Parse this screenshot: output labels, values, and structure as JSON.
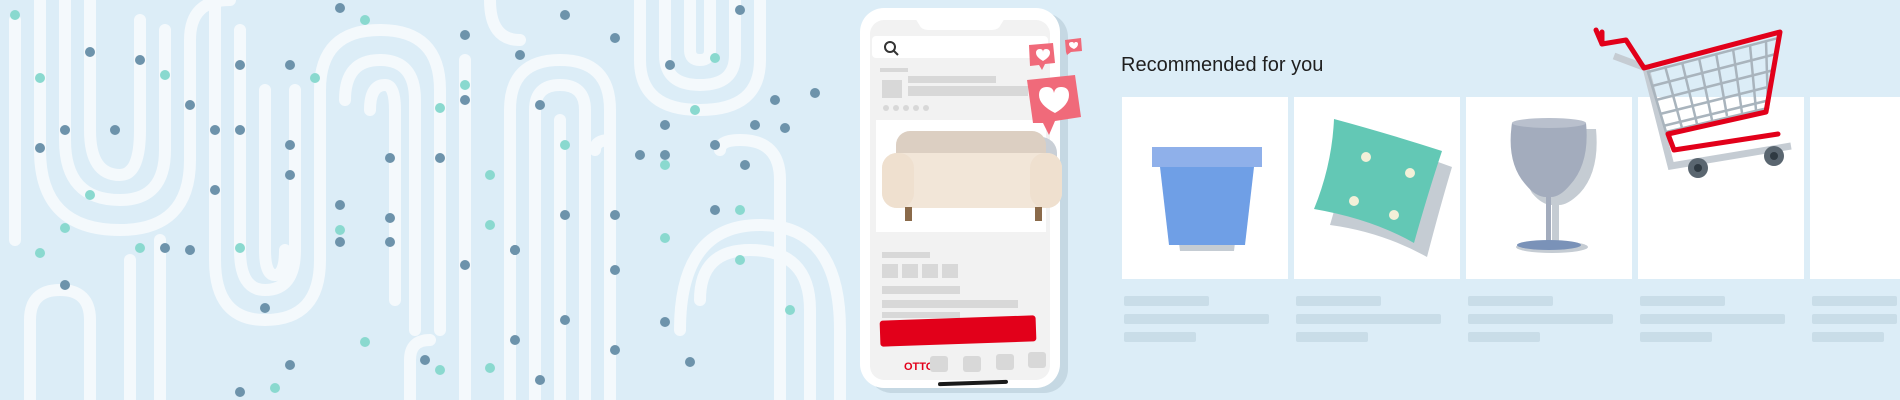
{
  "section": {
    "title": "Recommended for you"
  },
  "phone": {
    "brand_logo": "OTTO",
    "rating_stars": 5,
    "nav_icon_count": 4,
    "notification_badges": 3
  },
  "products": [
    {
      "name": "plant-pot-icon"
    },
    {
      "name": "cushion-icon"
    },
    {
      "name": "wine-glass-icon"
    },
    {
      "name": "empty-product"
    },
    {
      "name": "empty-product"
    }
  ],
  "colors": {
    "background": "#dcedf7",
    "accent_red": "#e2001a",
    "dot_blue": "#6d93ab",
    "dot_teal": "#8ad9cf",
    "card": "#ffffff",
    "skeleton": "#c9dde8"
  },
  "icons": [
    "search-icon",
    "heart-icon",
    "sofa-icon",
    "shopping-cart-icon",
    "plant-pot-icon",
    "cushion-icon",
    "wine-glass-icon"
  ]
}
